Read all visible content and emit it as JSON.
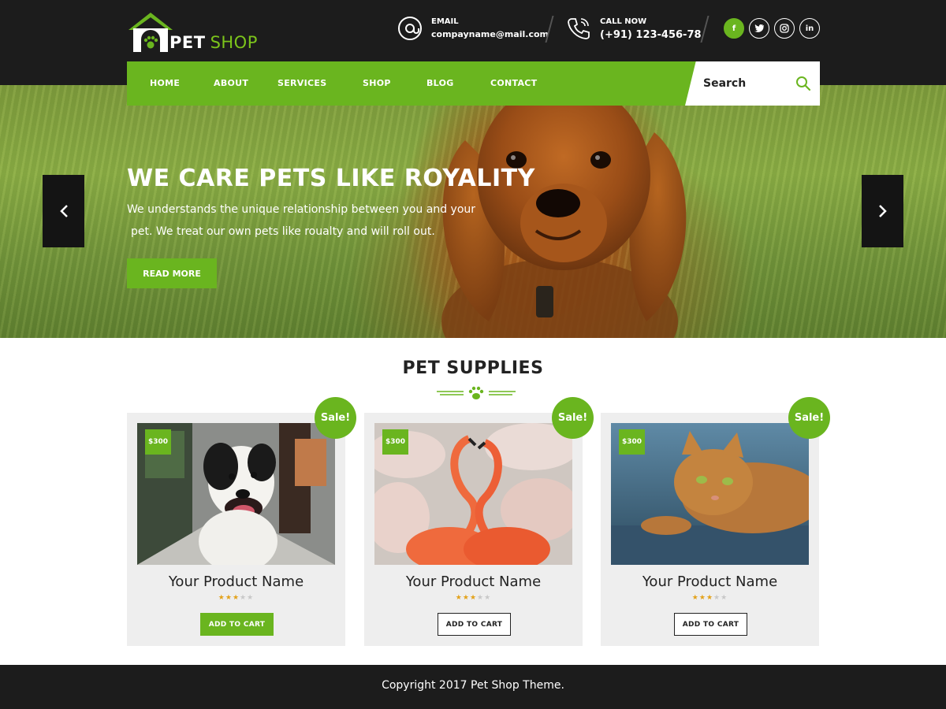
{
  "brand": {
    "name_part1": "PET",
    "name_part2": "SHOP"
  },
  "contact": {
    "email_label": "EMAIL",
    "email_value": "compayname@mail.com",
    "call_label": "CALL NOW",
    "call_value": "(+91) 123-456-78"
  },
  "social": [
    {
      "icon": "facebook-icon",
      "glyph": "f"
    },
    {
      "icon": "twitter-icon",
      "glyph": "t"
    },
    {
      "icon": "instagram-icon",
      "glyph": "◎"
    },
    {
      "icon": "linkedin-icon",
      "glyph": "in"
    }
  ],
  "nav": {
    "items": [
      "HOME",
      "ABOUT",
      "SERVICES",
      "SHOP",
      "BLOG",
      "CONTACT"
    ],
    "search_placeholder": "Search"
  },
  "hero": {
    "title": "WE CARE PETS LIKE ROYALITY",
    "line1": "We understands the unique relationship between you and your",
    "line2": "pet. We treat our own pets like roualty and will roll out.",
    "button": "READ MORE"
  },
  "section": {
    "title_bold": "PET",
    "title_rest": "SUPPLIES"
  },
  "products": [
    {
      "price": "$300",
      "badge": "Sale!",
      "name": "Your Product Name",
      "rating": 3,
      "rating_max": 5,
      "button": "ADD TO CART"
    },
    {
      "price": "$300",
      "badge": "Sale!",
      "name": "Your Product Name",
      "rating": 3,
      "rating_max": 5,
      "button": "ADD TO CART"
    },
    {
      "price": "$300",
      "badge": "Sale!",
      "name": "Your Product Name",
      "rating": 3,
      "rating_max": 5,
      "button": "ADD TO CART"
    }
  ],
  "footer": {
    "copyright": "Copyright 2017 Pet Shop Theme."
  },
  "colors": {
    "accent": "#6ab51f",
    "dark": "#1c1c1c",
    "card_bg": "#eeeeee"
  }
}
